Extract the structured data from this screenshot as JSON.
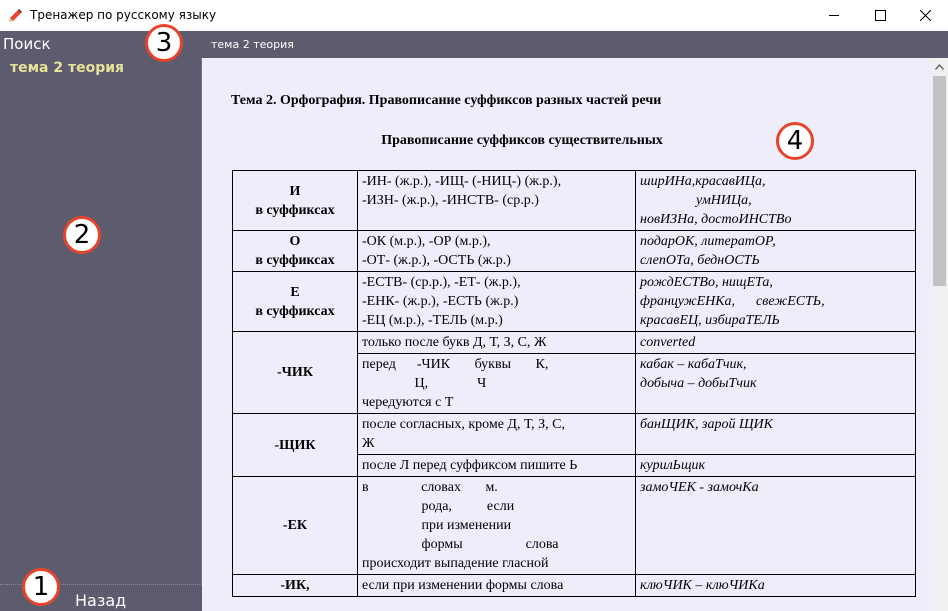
{
  "window": {
    "title": "Тренажер по русскому языку"
  },
  "topbar": {
    "search_label": "Поиск",
    "topic_title": "тема 2 теория"
  },
  "sidebar": {
    "items": [
      {
        "label": "тема 2 теория"
      }
    ],
    "back_label": "Назад"
  },
  "document": {
    "title": "Тема 2. Орфография. Правописание суффиксов разных частей речи",
    "subtitle": "Правописание суффиксов существительных",
    "rows": [
      {
        "head": "И\nв суффиксах",
        "rule": "-ИН- (ж.р.), -ИЩ- (-НИЦ-) (ж.р.),\n-ИЗН- (ж.р.), -ИНСТВ- (ср.р.)",
        "examples": "ширИНа,красавИЦа,\n                умНИЦа,\nновИЗНа, достоИНСТВо"
      },
      {
        "head": "О\nв суффиксах",
        "rule": "-ОК (м.р.), -ОР (м.р.),\n-ОТ- (ж.р.), -ОСТЬ (ж.р.)",
        "examples": "подарОК, литератОР,\nслепОТа, беднОСТЬ"
      },
      {
        "head": "Е\nв суффиксах",
        "rule": "-ЕСТВ- (ср.р.), -ЕТ- (ж.р.),\n-ЕНК- (ж.р.), -ЕСТЬ (ж.р.)\n-ЕЦ (м.р.), -ТЕЛЬ (м.р.)",
        "examples": "рождЕСТВо, нищЕТа,\nфранцужЕНКа,      свежЕСТЬ,\nкрасавЕЦ, избираТЕЛЬ"
      },
      {
        "head": "-ЧИК",
        "sub": [
          {
            "rule": "только после букв Д, Т, З, С, Ж",
            "examples": "converted"
          },
          {
            "rule": "перед      -ЧИК       буквы       К,\n               Ц,              Ч\nчередуются с Т",
            "examples": "кабак – кабаТчик,\nдобыча – добыТчик"
          }
        ]
      },
      {
        "head": "-ЩИК",
        "sub": [
          {
            "rule": "после согласных, кроме Д, Т, З, С,\nЖ",
            "examples": "банЩИК, зарой ЩИК"
          },
          {
            "rule": "после Л перед суффиксом пишите Ь",
            "examples": "курилЬщик"
          }
        ]
      },
      {
        "head": "-ЕК",
        "rule": "в               словах       м.\n                 рода,          если\n                 при изменении\n                 формы                  слова\nпроисходит выпадение гласной",
        "examples": "замоЧЕК - замочКа"
      },
      {
        "head": "-ИК,",
        "rule": "если при изменении формы слова",
        "examples": "клюЧИК – клюЧИКа"
      }
    ],
    "chik_example_1": "converted"
  },
  "markers": [
    "1",
    "2",
    "3",
    "4"
  ],
  "colors": {
    "chrome": "#5c5c6e",
    "content_bg": "#eeeefa",
    "sidebar_item": "#e6e29a",
    "marker": "#e8442c"
  }
}
